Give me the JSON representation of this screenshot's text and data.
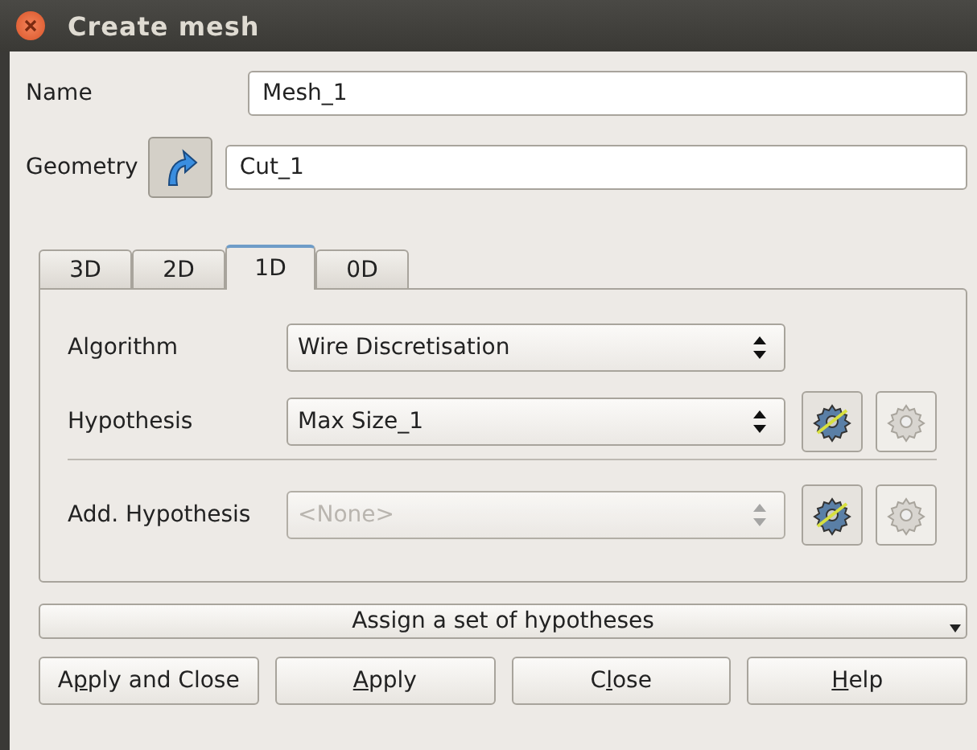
{
  "window": {
    "title": "Create mesh"
  },
  "name": {
    "label": "Name",
    "value": "Mesh_1"
  },
  "geometry": {
    "label": "Geometry",
    "value": "Cut_1"
  },
  "tabs": [
    {
      "label": "3D",
      "selected": false
    },
    {
      "label": "2D",
      "selected": false
    },
    {
      "label": "1D",
      "selected": true
    },
    {
      "label": "0D",
      "selected": false
    }
  ],
  "rows": [
    {
      "label": "Algorithm",
      "value": "Wire Discretisation",
      "disabled": false,
      "placeholder": false,
      "tools": false
    },
    {
      "label": "Hypothesis",
      "value": "Max Size_1",
      "disabled": false,
      "placeholder": false,
      "tools": true
    },
    {
      "label": "Add. Hypothesis",
      "value": "<None>",
      "disabled": true,
      "placeholder": true,
      "tools": true
    }
  ],
  "assign": {
    "label": "Assign a set of hypotheses"
  },
  "buttons": [
    {
      "pre": "A",
      "key": "p",
      "post": "ply and Close"
    },
    {
      "key": "A",
      "post": "pply"
    },
    {
      "pre": "C",
      "key": "l",
      "post": "ose"
    },
    {
      "key": "H",
      "post": "elp"
    }
  ]
}
